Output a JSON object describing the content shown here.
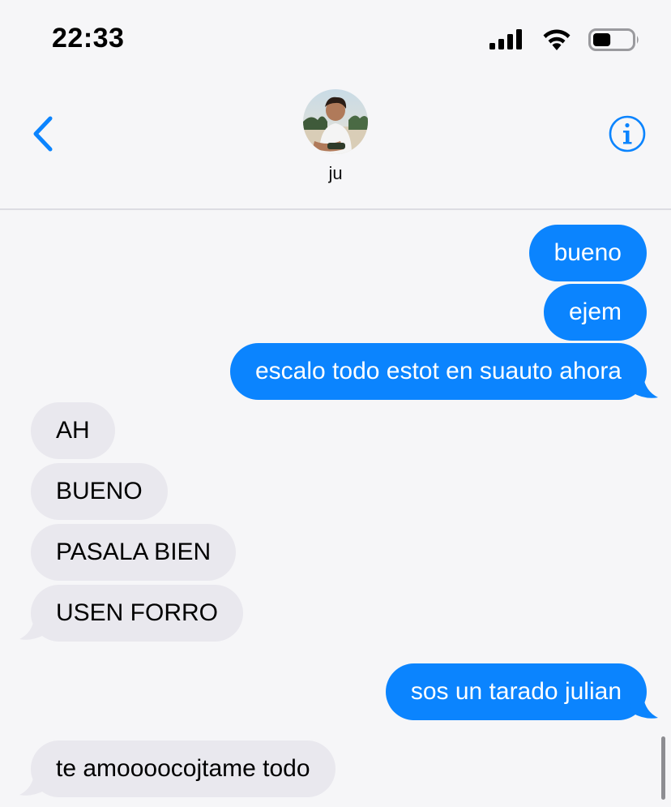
{
  "status_bar": {
    "time": "22:33",
    "battery_level": 0.45
  },
  "header": {
    "contact_name": "ju"
  },
  "messages": [
    {
      "direction": "sent",
      "text": "bueno"
    },
    {
      "direction": "sent",
      "text": "ejem"
    },
    {
      "direction": "sent",
      "text": "escalo todo estot en suauto ahora"
    },
    {
      "direction": "received",
      "text": "AH"
    },
    {
      "direction": "received",
      "text": "BUENO"
    },
    {
      "direction": "received",
      "text": "PASALA BIEN"
    },
    {
      "direction": "received",
      "text": "USEN FORRO"
    },
    {
      "direction": "sent",
      "text": "sos un tarado julian"
    },
    {
      "direction": "received",
      "text": "te amoooocojtame todo"
    }
  ],
  "colors": {
    "accent": "#0b84fe",
    "sent_bubble": "#0b84fe",
    "received_bubble": "#e9e8ee",
    "background": "#f6f6f8"
  },
  "icons": {
    "back": "chevron-left-icon",
    "info": "info-icon",
    "signal": "cellular-signal-icon",
    "wifi": "wifi-icon",
    "battery": "battery-icon"
  }
}
